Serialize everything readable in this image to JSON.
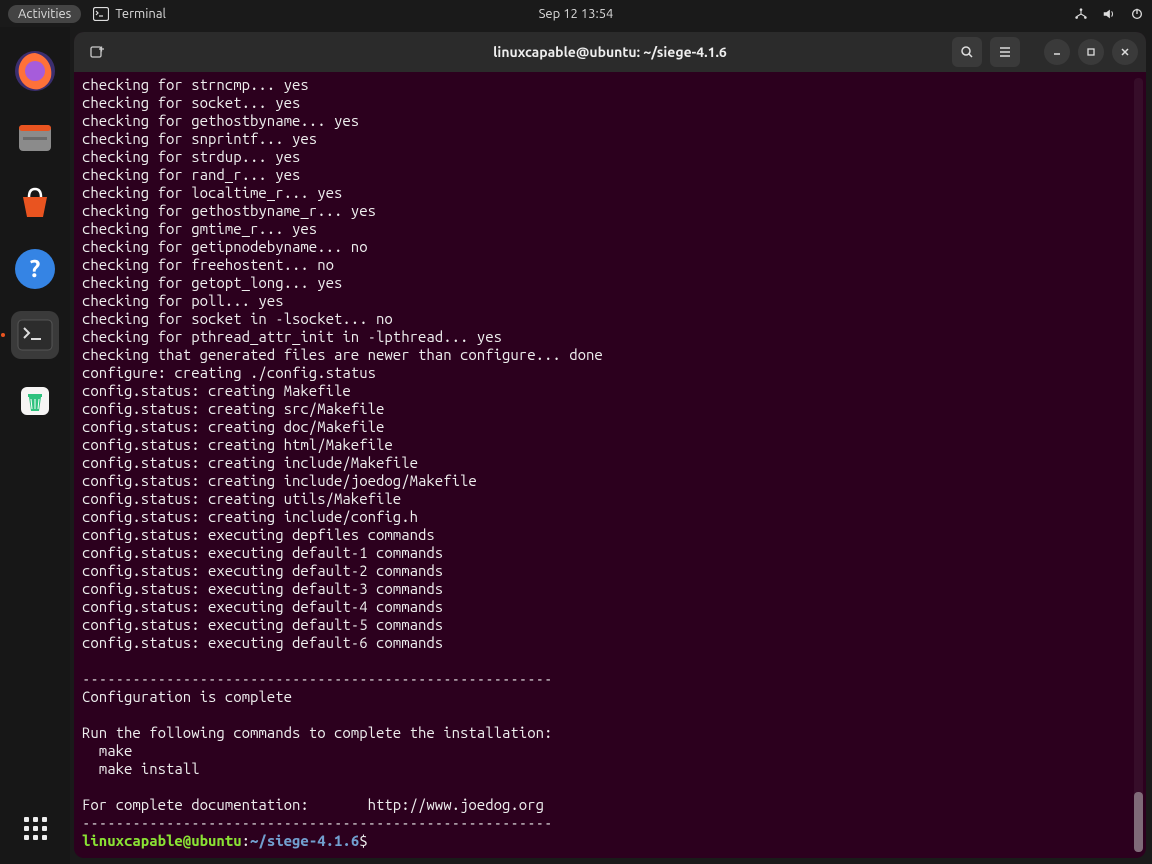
{
  "topbar": {
    "activities": "Activities",
    "app_name": "Terminal",
    "clock": "Sep 12  13:54"
  },
  "window": {
    "title": "linuxcapable@ubuntu: ~/siege-4.1.6"
  },
  "prompt": {
    "user_host": "linuxcapable@ubuntu",
    "separator": ":",
    "path": "~/siege-4.1.6",
    "symbol": "$"
  },
  "terminal_lines": [
    "checking for strncmp... yes",
    "checking for socket... yes",
    "checking for gethostbyname... yes",
    "checking for snprintf... yes",
    "checking for strdup... yes",
    "checking for rand_r... yes",
    "checking for localtime_r... yes",
    "checking for gethostbyname_r... yes",
    "checking for gmtime_r... yes",
    "checking for getipnodebyname... no",
    "checking for freehostent... no",
    "checking for getopt_long... yes",
    "checking for poll... yes",
    "checking for socket in -lsocket... no",
    "checking for pthread_attr_init in -lpthread... yes",
    "checking that generated files are newer than configure... done",
    "configure: creating ./config.status",
    "config.status: creating Makefile",
    "config.status: creating src/Makefile",
    "config.status: creating doc/Makefile",
    "config.status: creating html/Makefile",
    "config.status: creating include/Makefile",
    "config.status: creating include/joedog/Makefile",
    "config.status: creating utils/Makefile",
    "config.status: creating include/config.h",
    "config.status: executing depfiles commands",
    "config.status: executing default-1 commands",
    "config.status: executing default-2 commands",
    "config.status: executing default-3 commands",
    "config.status: executing default-4 commands",
    "config.status: executing default-5 commands",
    "config.status: executing default-6 commands",
    "",
    "--------------------------------------------------------",
    "Configuration is complete",
    "",
    "Run the following commands to complete the installation:",
    "  make",
    "  make install",
    "",
    "For complete documentation:       http://www.joedog.org",
    "--------------------------------------------------------"
  ]
}
